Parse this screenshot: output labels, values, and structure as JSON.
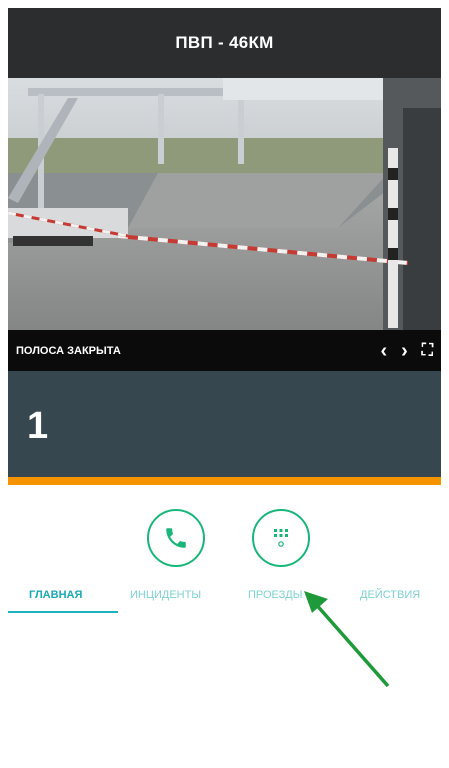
{
  "header": {
    "title": "ПВП - 46КМ"
  },
  "camera": {
    "status": "ПОЛОСА ЗАКРЫТА",
    "controls": {
      "prev": "‹",
      "next": "›",
      "fullscreen": "⛶"
    }
  },
  "lane": {
    "number": "1"
  },
  "action_buttons": [
    {
      "icon": "phone-icon"
    },
    {
      "icon": "dialpad-icon"
    }
  ],
  "tabs": [
    {
      "label": "ГЛАВНАЯ",
      "active": true
    },
    {
      "label": "ИНЦИДЕНТЫ",
      "active": false
    },
    {
      "label": "ПРОЕЗДЫ",
      "active": false
    },
    {
      "label": "ДЕЙСТВИЯ",
      "active": false
    }
  ],
  "colors": {
    "accent": "#19b67a",
    "tab_active": "#1aa9b4",
    "lane_bg": "#37474f",
    "lane_border": "#f59300",
    "header_bg": "#2b2d2f"
  }
}
